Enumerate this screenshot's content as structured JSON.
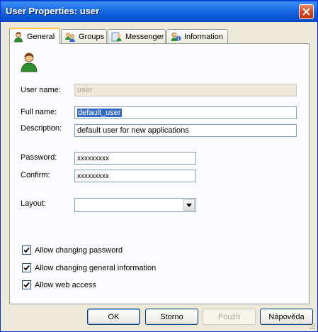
{
  "window": {
    "title": "User Properties: user"
  },
  "tabs": [
    {
      "label": "General",
      "icon": "user-icon",
      "active": true
    },
    {
      "label": "Groups",
      "icon": "groups-icon",
      "active": false
    },
    {
      "label": "Messenger",
      "icon": "messenger-icon",
      "active": false
    },
    {
      "label": "Information",
      "icon": "information-icon",
      "active": false
    }
  ],
  "general": {
    "user_name": {
      "label": "User name:",
      "value": "user"
    },
    "full_name": {
      "label": "Full name:",
      "value": "default_user"
    },
    "description": {
      "label": "Description:",
      "value": "default  user for new applications"
    },
    "password": {
      "label": "Password:",
      "value": "xxxxxxxxx"
    },
    "confirm": {
      "label": "Confirm:",
      "value": "xxxxxxxxx"
    },
    "layout": {
      "label": "Layout:",
      "value": ""
    }
  },
  "checkboxes": [
    {
      "label": "Allow changing password",
      "checked": true
    },
    {
      "label": "Allow changing general information",
      "checked": true
    },
    {
      "label": "Allow web access",
      "checked": true
    }
  ],
  "buttons": {
    "ok": "OK",
    "cancel": "Storno",
    "apply": "Použít",
    "help": "Nápověda"
  }
}
